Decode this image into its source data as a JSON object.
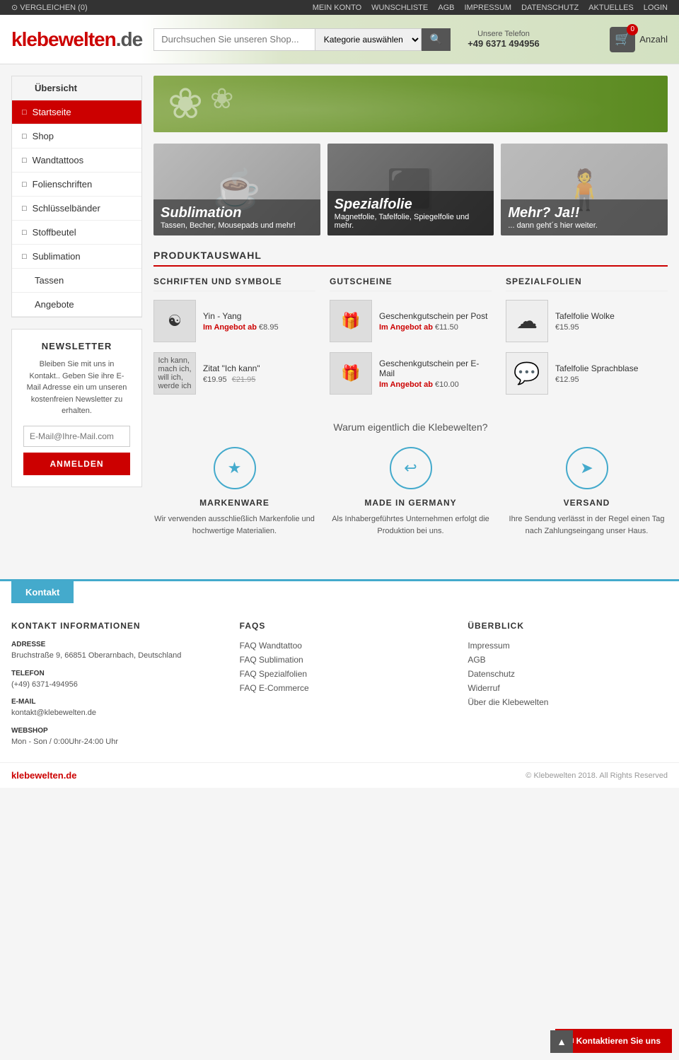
{
  "topbar": {
    "compare_label": "⊙ VERGLEICHEN (0)",
    "nav_items": [
      {
        "label": "MEIN KONTO",
        "key": "mein-konto"
      },
      {
        "label": "WUNSCHLISTE",
        "key": "wunschliste"
      },
      {
        "label": "AGB",
        "key": "agb"
      },
      {
        "label": "IMPRESSUM",
        "key": "impressum"
      },
      {
        "label": "DATENSCHUTZ",
        "key": "datenschutz"
      },
      {
        "label": "AKTUELLES",
        "key": "aktuelles"
      },
      {
        "label": "LOGIN",
        "key": "login"
      }
    ]
  },
  "header": {
    "logo": "klebewelten",
    "logo_suffix": ".de",
    "search_placeholder": "Durchsuchen Sie unseren Shop...",
    "search_category": "Kategorie auswählen",
    "phone_label": "Unsere Telefon",
    "phone_number": "+49 6371 494956",
    "cart_count": "0",
    "cart_label": "Anzahl"
  },
  "sidebar": {
    "items": [
      {
        "label": "Übersicht",
        "icon": false,
        "active": false,
        "key": "ubersicht"
      },
      {
        "label": "Startseite",
        "icon": true,
        "active": true,
        "key": "startseite"
      },
      {
        "label": "Shop",
        "icon": true,
        "active": false,
        "key": "shop"
      },
      {
        "label": "Wandtattoos",
        "icon": true,
        "active": false,
        "key": "wandtattoos"
      },
      {
        "label": "Folienschriften",
        "icon": true,
        "active": false,
        "key": "folienschriften"
      },
      {
        "label": "Schlüsselbänder",
        "icon": true,
        "active": false,
        "key": "schlusselbander"
      },
      {
        "label": "Stoffbeutel",
        "icon": true,
        "active": false,
        "key": "stoffbeutel"
      },
      {
        "label": "Sublimation",
        "icon": true,
        "active": false,
        "key": "sublimation"
      },
      {
        "label": "Tassen",
        "icon": false,
        "active": false,
        "key": "tassen"
      },
      {
        "label": "Angebote",
        "icon": false,
        "active": false,
        "key": "angebote"
      }
    ]
  },
  "newsletter": {
    "title": "NEWSLETTER",
    "text": "Bleiben Sie mit uns in Kontakt.. Geben Sie ihre E-Mail Adresse ein um unseren kostenfreien Newsletter zu erhalten.",
    "placeholder": "E-Mail@Ihre-Mail.com",
    "button": "ANMELDEN"
  },
  "banners": [
    {
      "title": "Sublimation",
      "subtitle": "Tassen, Becher, Mousepads und mehr!",
      "icon": "☕",
      "key": "sublimation-banner"
    },
    {
      "title": "Spezialfolie",
      "subtitle": "Magnetfolie, Tafelfolie, Spiegelfolie und mehr.",
      "icon": "⬛",
      "key": "spezialfolie-banner"
    },
    {
      "title": "Mehr? Ja!!",
      "subtitle": "... dann geht´s hier weiter.",
      "icon": "🧍",
      "key": "mehr-banner"
    }
  ],
  "section_title": "PRODUKTAUSWAHL",
  "product_columns": [
    {
      "title": "SCHRIFTEN UND SYMBOLE",
      "key": "schriften",
      "items": [
        {
          "name": "Yin - Yang",
          "price_label": "Im Angebot ab",
          "price": "€8.95",
          "old_price": null,
          "icon": "☯"
        },
        {
          "name": "Zitat \"Ich kann\"",
          "price_label": null,
          "price": "€19.95",
          "old_price": "€21.95",
          "icon": "🏷"
        }
      ]
    },
    {
      "title": "GUTSCHEINE",
      "key": "gutscheine",
      "items": [
        {
          "name": "Geschenkgutschein per Post",
          "price_label": "Im Angebot ab",
          "price": "€11.50",
          "old_price": null,
          "icon": "🎁"
        },
        {
          "name": "Geschenkgutschein per E-Mail",
          "price_label": "Im Angebot ab",
          "price": "€10.00",
          "old_price": null,
          "icon": "🎁"
        }
      ]
    },
    {
      "title": "SPEZIALFOLIEN",
      "key": "spezialfolien",
      "items": [
        {
          "name": "Tafelfolie Wolke",
          "price_label": null,
          "price": "€15.95",
          "old_price": null,
          "icon": "☁"
        },
        {
          "name": "Tafelfolie Sprachblase",
          "price_label": null,
          "price": "€12.95",
          "old_price": null,
          "icon": "💬"
        }
      ]
    }
  ],
  "why_section": {
    "title": "Warum eigentlich die Klebewelten?",
    "items": [
      {
        "icon": "★",
        "title": "MARKENWARE",
        "text": "Wir verwenden ausschließlich Markenfolie und hochwertige Materialien.",
        "key": "markenware"
      },
      {
        "icon": "↩",
        "title": "MADE IN GERMANY",
        "text": "Als Inhabergeführtes Unternehmen erfolgt die Produktion bei uns.",
        "key": "made-in-germany"
      },
      {
        "icon": "➤",
        "title": "VERSAND",
        "text": "Ihre Sendung verlässt in der Regel einen Tag nach Zahlungseingang unser Haus.",
        "key": "versand"
      }
    ]
  },
  "footer": {
    "kontakt_bar": "Kontakt",
    "columns": [
      {
        "title": "KONTAKT INFORMATIONEN",
        "key": "kontakt-info",
        "fields": [
          {
            "label": "ADRESSE",
            "value": "Bruchstraße 9, 66851 Oberarnbach, Deutschland"
          },
          {
            "label": "TELEFON",
            "value": "(+49) 6371-494956"
          },
          {
            "label": "E-MAIL",
            "value": "kontakt@klebewelten.de"
          },
          {
            "label": "WEBSHOP",
            "value": "Mon - Son / 0:00Uhr-24:00 Uhr"
          }
        ]
      },
      {
        "title": "FAQS",
        "key": "faqs",
        "links": [
          {
            "label": "FAQ Wandtattoo"
          },
          {
            "label": "FAQ Sublimation"
          },
          {
            "label": "FAQ Spezialfolien"
          },
          {
            "label": "FAQ E-Commerce"
          }
        ]
      },
      {
        "title": "ÜBERBLICK",
        "key": "uberblick",
        "links": [
          {
            "label": "Impressum"
          },
          {
            "label": "AGB"
          },
          {
            "label": "Datenschutz"
          },
          {
            "label": "Widerruf"
          },
          {
            "label": "Über die Klebewelten"
          }
        ]
      }
    ],
    "bottom_logo": "klebewelten.de",
    "bottom_copy": "© Klebewelten 2018. All Rights Reserved",
    "kontakt_button": "✉ Kontaktieren Sie uns",
    "scroll_top": "▲"
  }
}
